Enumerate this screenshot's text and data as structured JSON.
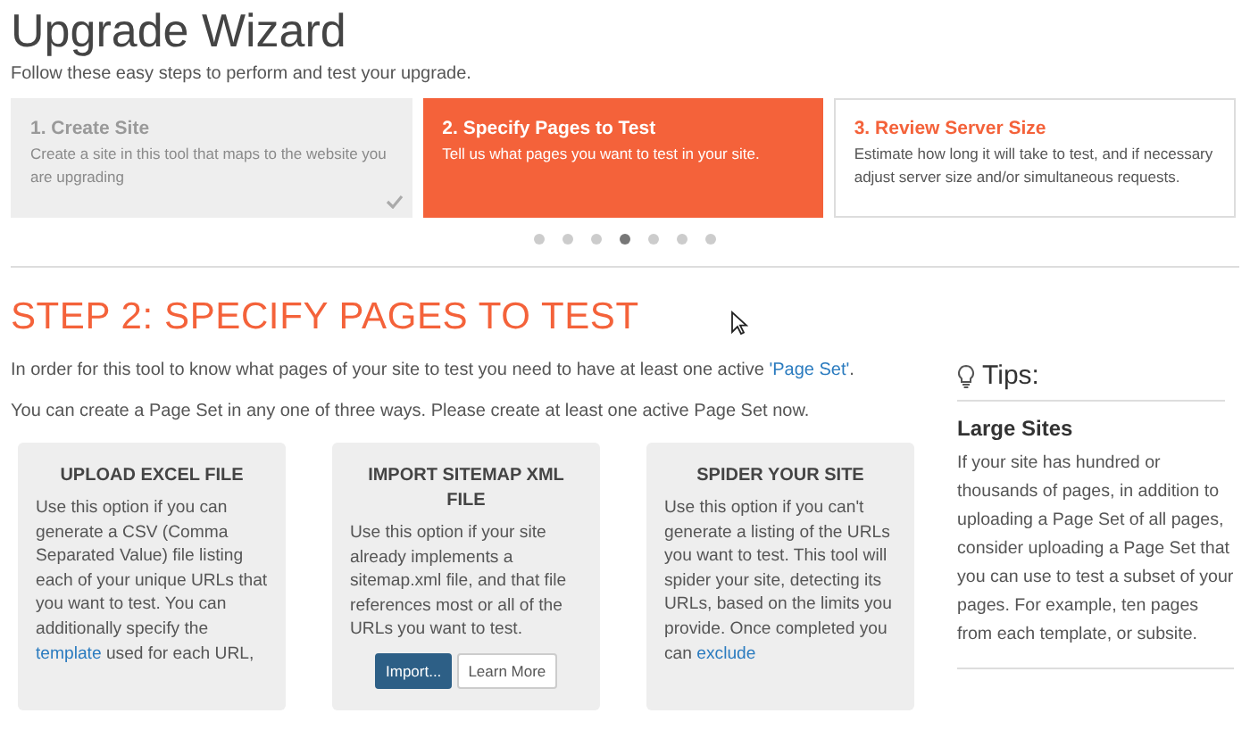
{
  "header": {
    "title": "Upgrade Wizard",
    "subtitle": "Follow these easy steps to perform and test your upgrade."
  },
  "steps": [
    {
      "title": "1. Create Site",
      "description": "Create a site in this tool that maps to the website you are upgrading",
      "selected": false,
      "completed": true
    },
    {
      "title": "2. Specify Pages to Test",
      "description": "Tell us what pages you want to test in your site.",
      "selected": true,
      "completed": false
    },
    {
      "title": "3. Review Server Size",
      "description": "Estimate how long it will take to test, and if necessary adjust server size and/or simultaneous requests.",
      "selected": false,
      "completed": false
    }
  ],
  "pager_dots": [
    {
      "selected": false
    },
    {
      "selected": false
    },
    {
      "selected": false
    },
    {
      "selected": true
    },
    {
      "selected": false
    },
    {
      "selected": false
    },
    {
      "selected": false
    }
  ],
  "heading": "STEP 2: SPECIFY PAGES TO TEST",
  "intro": [
    [
      {
        "kind": "text",
        "text": "In order for this tool to know what pages of your site to test you need to have at least one active "
      },
      {
        "kind": "link",
        "text": "'Page Set'"
      },
      {
        "kind": "text",
        "text": "."
      }
    ],
    [
      {
        "kind": "text",
        "text": "You can create a Page Set in any one of three ways. Please create at least one active Page Set now."
      }
    ]
  ],
  "options": [
    {
      "title": "UPLOAD EXCEL FILE",
      "body": [
        {
          "kind": "text",
          "text": "Use this option if you can generate a CSV (Comma Separated Value) file listing each of your unique URLs that you want to test. You can additionally specify the "
        },
        {
          "kind": "link",
          "text": "template"
        },
        {
          "kind": "text",
          "text": " used for each URL,"
        }
      ]
    },
    {
      "title": "IMPORT SITEMAP XML FILE",
      "body": [
        {
          "kind": "text",
          "text": "Use this option if your site already implements a sitemap.xml file, and that file references most or all of the URLs you want to test."
        }
      ],
      "buttons": [
        {
          "label": "Import...",
          "kind": "primary"
        },
        {
          "label": "Learn More",
          "kind": "secondary"
        }
      ]
    },
    {
      "title": "SPIDER YOUR SITE",
      "body": [
        {
          "kind": "text",
          "text": "Use this option if you can't generate a listing of the URLs you want to test. This tool will spider your site, detecting its URLs, based on the limits you provide. Once completed you can "
        },
        {
          "kind": "link",
          "text": "exclude"
        }
      ]
    }
  ],
  "tips": {
    "title": "Tips:",
    "subtitle": "Large Sites",
    "text": "If your site has hundred or thousands of pages, in addition to uploading a Page Set of all pages, consider uploading a Page Set that you can use to test a subset of your pages. For example, ten pages from each template, or subsite."
  }
}
